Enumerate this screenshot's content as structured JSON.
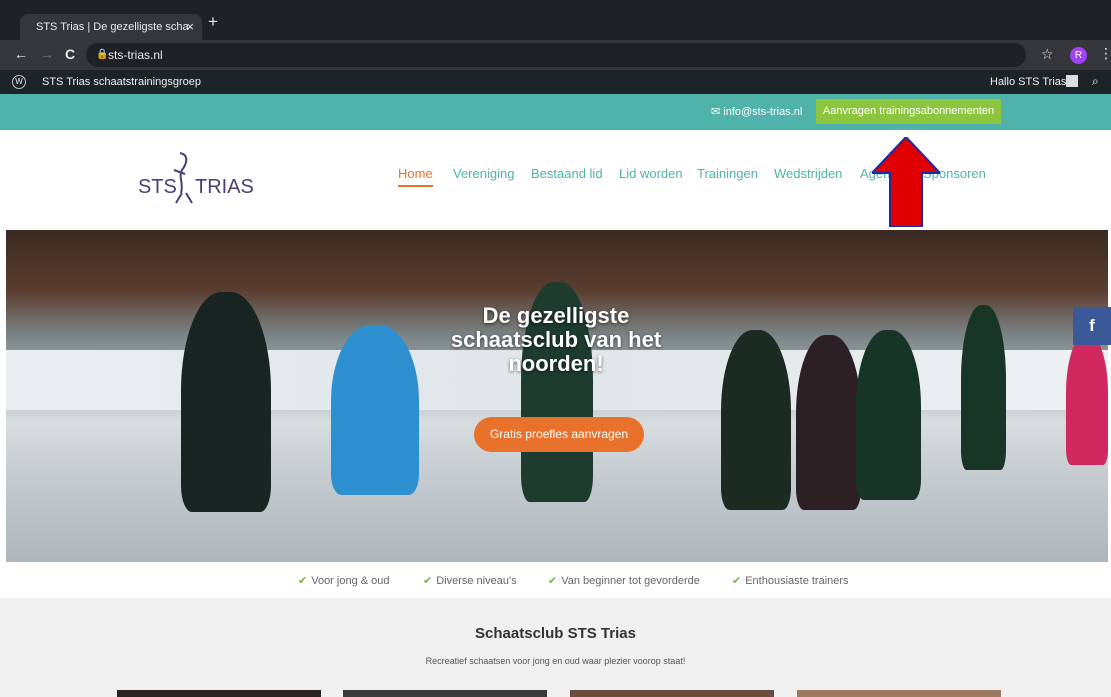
{
  "browser": {
    "tab_title": "STS Trias | De gezelligste scha",
    "tab_close": "×",
    "new_tab": "+",
    "url": "sts-trias.nl",
    "back": "←",
    "forward": "→",
    "reload": "C",
    "star": "☆",
    "avatar_initial": "R",
    "menu": "⋮"
  },
  "wp_admin": {
    "site_name": "STS Trias schaatstrainingsgroep",
    "greeting": "Hallo STS Trias",
    "logo": "W",
    "search": "⌕"
  },
  "topbar": {
    "email": "info@sts-trias.nl",
    "cta": "Aanvragen trainingsabonnementen"
  },
  "header": {
    "logo_left": "STS",
    "logo_right": "TRIAS",
    "menu": [
      "Home",
      "Vereniging",
      "Bestaand lid",
      "Lid worden",
      "Trainingen",
      "Wedstrijden",
      "Agenda",
      "Sponsoren"
    ]
  },
  "hero": {
    "title": "De gezelligste schaatsclub van het noorden!",
    "cta": "Gratis proefles aanvragen",
    "facebook": "f"
  },
  "usps": [
    "Voor jong & oud",
    "Diverse niveau's",
    "Van beginner tot gevorderde",
    "Enthousiaste trainers"
  ],
  "club": {
    "title": "Schaatsclub STS Trias",
    "subtitle": "Recreatief schaatsen voor jong en oud waar plezier voorop staat!"
  },
  "colors": {
    "teal": "#4fb3a9",
    "green": "#8cc63f",
    "orange": "#e8722c",
    "facebook": "#3b5998",
    "arrow": "#e00000"
  }
}
